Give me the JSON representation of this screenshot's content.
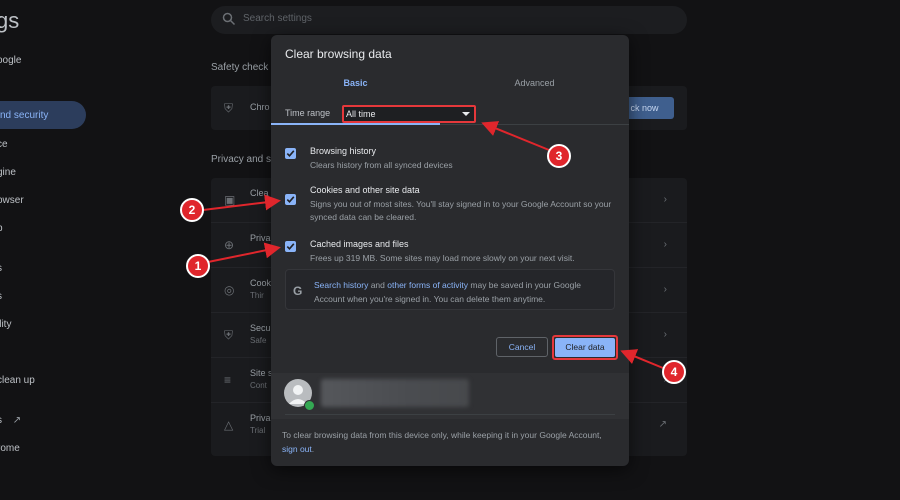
{
  "background": {
    "title": "gs",
    "search_placeholder": "Search settings",
    "sidebar": [
      {
        "label": "oogle"
      },
      {
        "label": "nd security"
      },
      {
        "label": "ce"
      },
      {
        "label": "gine"
      },
      {
        "label": "owser"
      },
      {
        "label": "p"
      },
      {
        "label": "s"
      },
      {
        "label": "s"
      },
      {
        "label": "ility"
      },
      {
        "label": "clean up"
      },
      {
        "label": "s"
      },
      {
        "label": "rome"
      }
    ],
    "safety_check_title": "Safety check",
    "safety_row_text": "Chro",
    "check_now_label": "ck now",
    "privacy_title": "Privacy and s",
    "privacy_rows": [
      {
        "t1": "Clea",
        "t2": ""
      },
      {
        "t1": "Priva",
        "t2": ""
      },
      {
        "t1": "Cook",
        "t2": "Thir"
      },
      {
        "t1": "Secu",
        "t2": "Safe"
      },
      {
        "t1": "Site s",
        "t2": "Cont"
      },
      {
        "t1": "Priva",
        "t2": "Trial"
      }
    ]
  },
  "dialog": {
    "title": "Clear browsing data",
    "tabs": {
      "basic": "Basic",
      "advanced": "Advanced"
    },
    "time_range": {
      "label": "Time range",
      "value": "All time"
    },
    "options": [
      {
        "title": "Browsing history",
        "desc": "Clears history from all synced devices",
        "checked": true
      },
      {
        "title": "Cookies and other site data",
        "desc": "Signs you out of most sites. You'll stay signed in to your Google Account so your synced data can be cleared.",
        "checked": true
      },
      {
        "title": "Cached images and files",
        "desc": "Frees up 319 MB. Some sites may load more slowly on your next visit.",
        "checked": true
      }
    ],
    "info": {
      "link1": "Search history",
      "and": " and ",
      "link2": "other forms of activity",
      "rest": " may be saved in your Google Account when you're signed in. You can delete them anytime."
    },
    "cancel_label": "Cancel",
    "clear_label": "Clear data",
    "footer": {
      "text": "To clear browsing data from this device only, while keeping it in your Google Account, ",
      "link": "sign out",
      "end": "."
    }
  },
  "annotations": [
    "1",
    "2",
    "3",
    "4"
  ],
  "colors": {
    "accent": "#8ab4f8",
    "highlight": "#e5383b",
    "callout": "#e0262c"
  }
}
